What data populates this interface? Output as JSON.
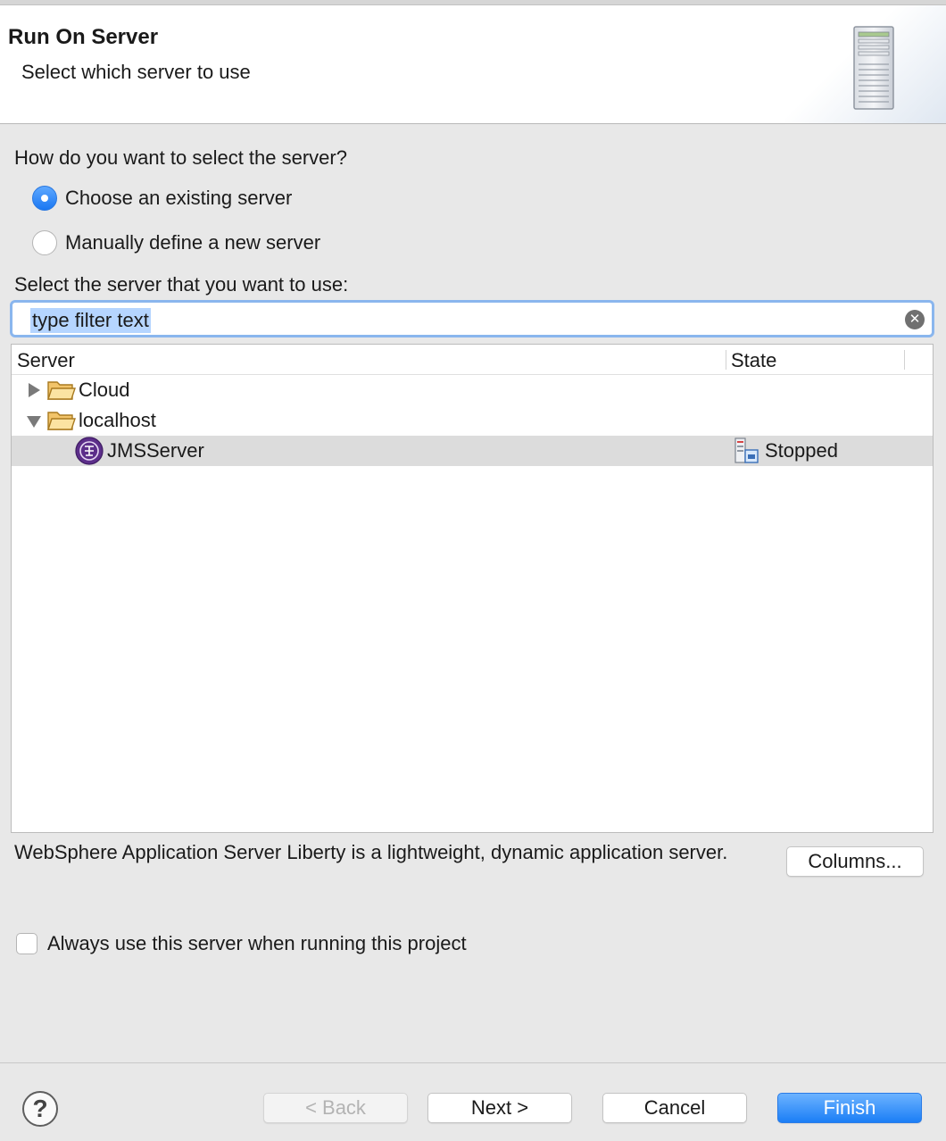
{
  "header": {
    "title": "Run On Server",
    "subtitle": "Select which server to use",
    "icon": "server-tower-icon"
  },
  "selection": {
    "question": "How do you want to select the server?",
    "options": [
      {
        "label": "Choose an existing server",
        "checked": true
      },
      {
        "label": "Manually define a new server",
        "checked": false
      }
    ],
    "list_label": "Select the server that you want to use:"
  },
  "filter": {
    "value": "type filter text",
    "clear_icon": "clear-search-icon"
  },
  "tree": {
    "columns": [
      "Server",
      "State"
    ],
    "rows": [
      {
        "label": "Cloud",
        "expanded": false,
        "icon": "folder-icon"
      },
      {
        "label": "localhost",
        "expanded": true,
        "icon": "folder-icon"
      },
      {
        "label": "JMSServer",
        "state": "Stopped",
        "icon": "liberty-server-icon",
        "state_icon": "server-stopped-icon",
        "selected": true
      }
    ]
  },
  "description": "WebSphere Application Server Liberty is a lightweight, dynamic application server.",
  "columns_button": "Columns...",
  "always_use": {
    "label": "Always use this server when running this project",
    "checked": false
  },
  "footer": {
    "help_icon": "help-icon",
    "back": "< Back",
    "next": "Next >",
    "cancel": "Cancel",
    "finish": "Finish"
  },
  "colors": {
    "accent": "#1b7ef6",
    "focus_ring": "#8ab6ee",
    "selection_row": "#dcdcdc",
    "text_selection": "#b5d5ff"
  }
}
